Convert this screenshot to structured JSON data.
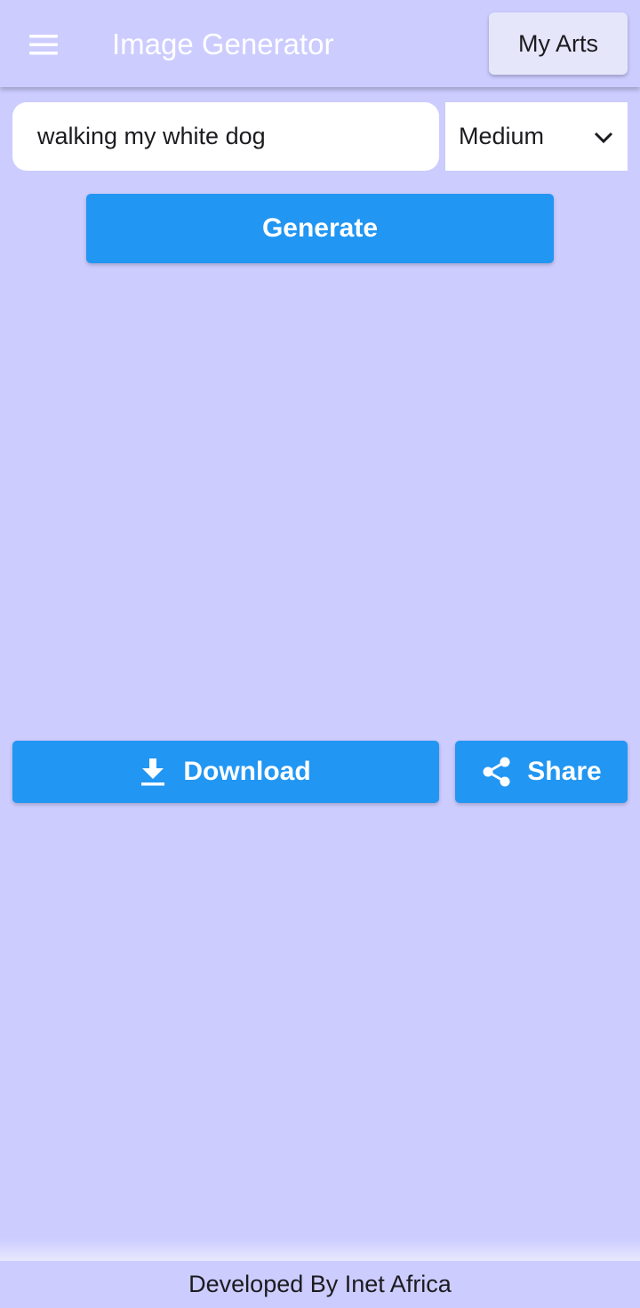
{
  "app_bar": {
    "title": "Image Generator",
    "menu_icon": "menu-icon",
    "my_arts_label": "My Arts"
  },
  "form": {
    "prompt_value": "walking my white dog",
    "size_selected": "Medium",
    "size_dropdown_icon": "chevron-down-icon",
    "generate_label": "Generate"
  },
  "actions": {
    "download_label": "Download",
    "download_icon": "download-icon",
    "share_label": "Share",
    "share_icon": "share-icon"
  },
  "footer": {
    "text": "Developed By Inet Africa"
  },
  "colors": {
    "background": "#CCCCFF",
    "primary": "#2196F3",
    "title_text": "#FFFFFF",
    "my_arts_bg": "#E6E6FB"
  }
}
